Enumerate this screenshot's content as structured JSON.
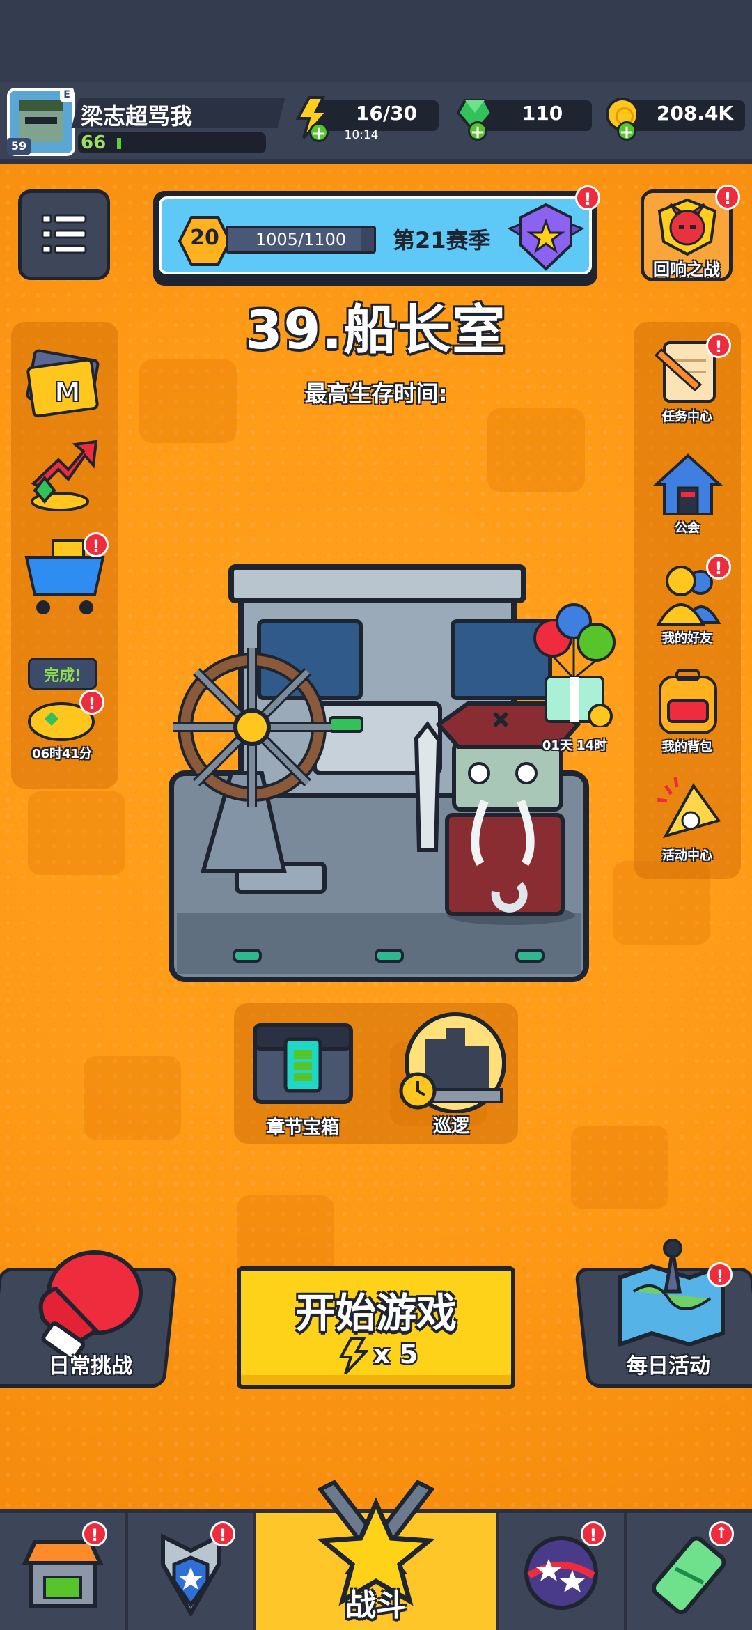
{
  "player": {
    "name": "梁志超骂我",
    "level": "59",
    "exp_value": "66",
    "avatar_tag": "E"
  },
  "resources": {
    "energy": "16/30",
    "energy_timer": "10:14",
    "gems": "110",
    "gold": "208.4K"
  },
  "season": {
    "tier": "20",
    "progress_text": "1005/1100",
    "progress": 0.914,
    "label": "第21赛季"
  },
  "stage": {
    "title": "39.船长室",
    "subtitle": "最高生存时间:"
  },
  "right_menu": {
    "echo_battle": "回响之战",
    "tasks": "任务中心",
    "guild": "公会",
    "friends": "我的好友",
    "backpack": "我的背包",
    "events": "活动中心"
  },
  "left_menu": {
    "complete_label": "完成!",
    "complete_timer": "06时41分"
  },
  "gift_timer": "01天 14时",
  "chapter_actions": {
    "chest": "章节宝箱",
    "patrol": "巡逻"
  },
  "bottom_buttons": {
    "daily_challenge": "日常挑战",
    "start_game": "开始游戏",
    "start_cost": "x 5",
    "daily_activity": "每日活动"
  },
  "nav": {
    "battle": "战斗"
  },
  "colors": {
    "accent_orange": "#ff9a16",
    "start_yellow": "#ffd21a",
    "dark_outline": "#1f2431",
    "alert_red": "#ef2b3e",
    "season_blue": "#58c4f5"
  }
}
